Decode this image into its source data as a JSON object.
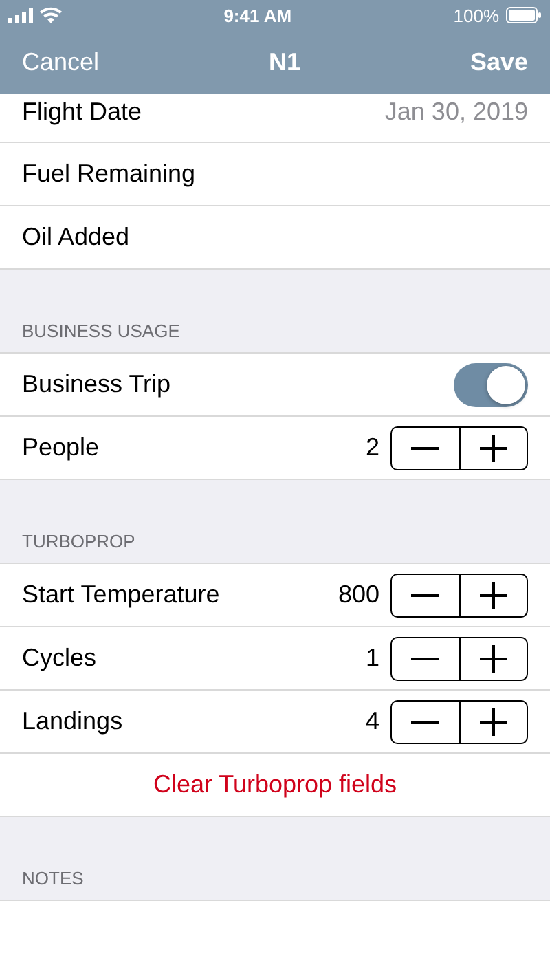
{
  "status_bar": {
    "time": "9:41 AM",
    "battery": "100%"
  },
  "nav": {
    "left": "Cancel",
    "title": "N1",
    "right": "Save"
  },
  "sections": [
    {
      "rows": [
        {
          "kind": "value",
          "label": "Flight Date",
          "value": "Jan 30, 2019"
        },
        {
          "kind": "plain",
          "label": "Fuel Remaining"
        },
        {
          "kind": "plain",
          "label": "Oil Added"
        }
      ]
    },
    {
      "header": "BUSINESS USAGE",
      "rows": [
        {
          "kind": "toggle",
          "label": "Business Trip",
          "on": true
        },
        {
          "kind": "stepper",
          "label": "People",
          "value": "2"
        }
      ]
    },
    {
      "header": "TURBOPROP",
      "rows": [
        {
          "kind": "stepper",
          "label": "Start Temperature",
          "value": "800"
        },
        {
          "kind": "stepper",
          "label": "Cycles",
          "value": "1"
        },
        {
          "kind": "stepper",
          "label": "Landings",
          "value": "4"
        },
        {
          "kind": "action",
          "label": "Clear Turboprop fields"
        }
      ]
    },
    {
      "header": "NOTES"
    }
  ]
}
